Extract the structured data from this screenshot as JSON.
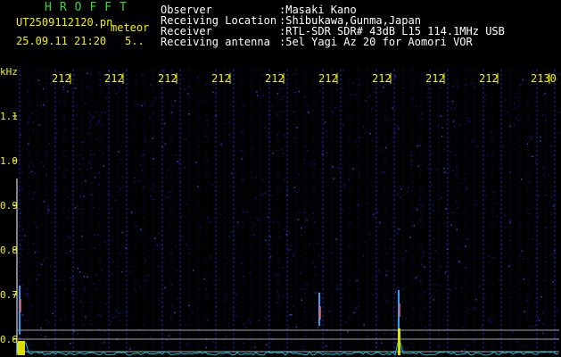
{
  "header": {
    "logo_text": "HROFFT",
    "filename": "UT2509112120.pn",
    "mode": "meteor",
    "timestamp": "25.09.11 21:20",
    "sub_value": "5.."
  },
  "info": {
    "observer_label": "Observer",
    "observer_value": ":Masaki Kano",
    "location_label": "Receiving Location",
    "location_value": ":Shibukawa,Gunma,Japan",
    "receiver_label": "Receiver",
    "receiver_value": ":RTL-SDR SDR# 43dB L15 114.1MHz USB",
    "antenna_label": "Receiving antenna",
    "antenna_value": ":5el Yagi Az 20 for Aomori VOR"
  },
  "axes": {
    "y_unit": "kHz",
    "y_ticks": [
      "1.1",
      "1.0",
      "0.9",
      "0.8",
      "0.7",
      "0.6"
    ],
    "x_ticks": [
      "212",
      "212",
      "212",
      "212",
      "212",
      "212",
      "212",
      "212",
      "212",
      "2130"
    ]
  },
  "colors": {
    "background": "#000000",
    "text": "#ffffff",
    "logo": "#3ad63a",
    "ticks": "#f2f200",
    "noise": "#14148a",
    "signal": "#2aa0ff",
    "baseline": "#00c8d8"
  }
}
